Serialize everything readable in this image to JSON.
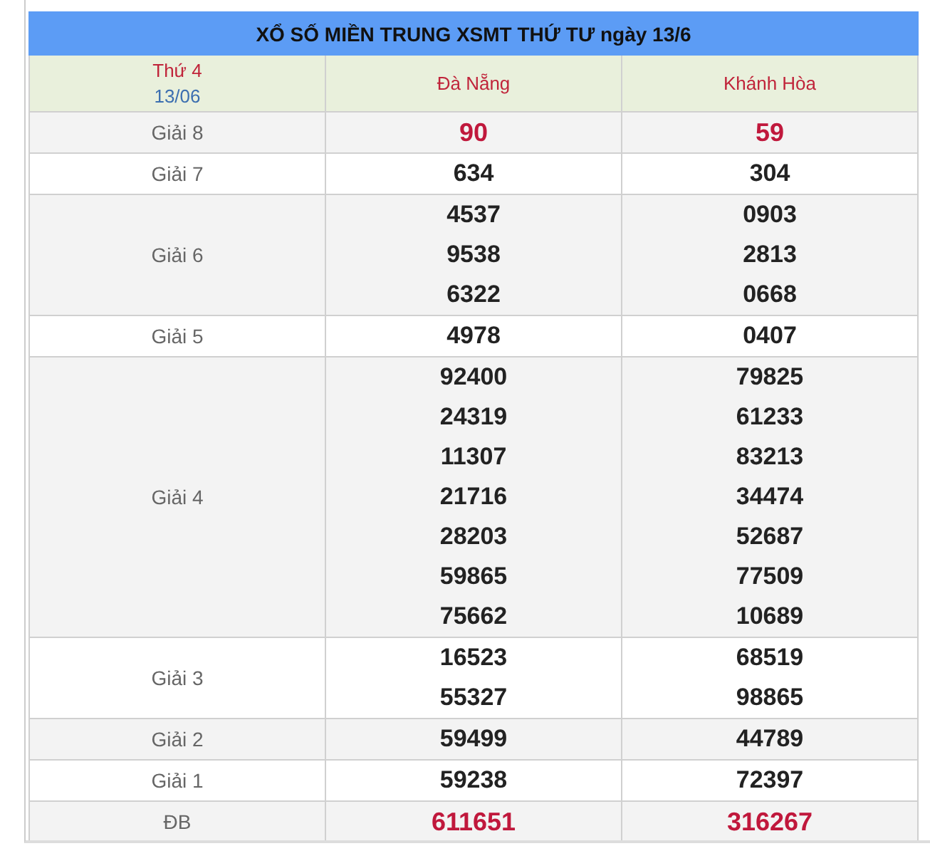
{
  "title": "XỔ SỐ MIỀN TRUNG XSMT THỨ TƯ ngày 13/6",
  "header": {
    "weekday": "Thứ 4",
    "date": "13/06",
    "provinces": [
      "Đà Nẵng",
      "Khánh Hòa"
    ]
  },
  "rows": [
    {
      "label": "Giải 8",
      "highlight": true,
      "values": [
        [
          "90"
        ],
        [
          "59"
        ]
      ]
    },
    {
      "label": "Giải 7",
      "highlight": false,
      "values": [
        [
          "634"
        ],
        [
          "304"
        ]
      ]
    },
    {
      "label": "Giải 6",
      "highlight": false,
      "values": [
        [
          "4537",
          "9538",
          "6322"
        ],
        [
          "0903",
          "2813",
          "0668"
        ]
      ]
    },
    {
      "label": "Giải 5",
      "highlight": false,
      "values": [
        [
          "4978"
        ],
        [
          "0407"
        ]
      ]
    },
    {
      "label": "Giải 4",
      "highlight": false,
      "values": [
        [
          "92400",
          "24319",
          "11307",
          "21716",
          "28203",
          "59865",
          "75662"
        ],
        [
          "79825",
          "61233",
          "83213",
          "34474",
          "52687",
          "77509",
          "10689"
        ]
      ]
    },
    {
      "label": "Giải 3",
      "highlight": false,
      "values": [
        [
          "16523",
          "55327"
        ],
        [
          "68519",
          "98865"
        ]
      ]
    },
    {
      "label": "Giải 2",
      "highlight": false,
      "values": [
        [
          "59499"
        ],
        [
          "44789"
        ]
      ]
    },
    {
      "label": "Giải 1",
      "highlight": false,
      "values": [
        [
          "59238"
        ],
        [
          "72397"
        ]
      ]
    },
    {
      "label": "ĐB",
      "highlight": true,
      "values": [
        [
          "611651"
        ],
        [
          "316267"
        ]
      ]
    }
  ]
}
